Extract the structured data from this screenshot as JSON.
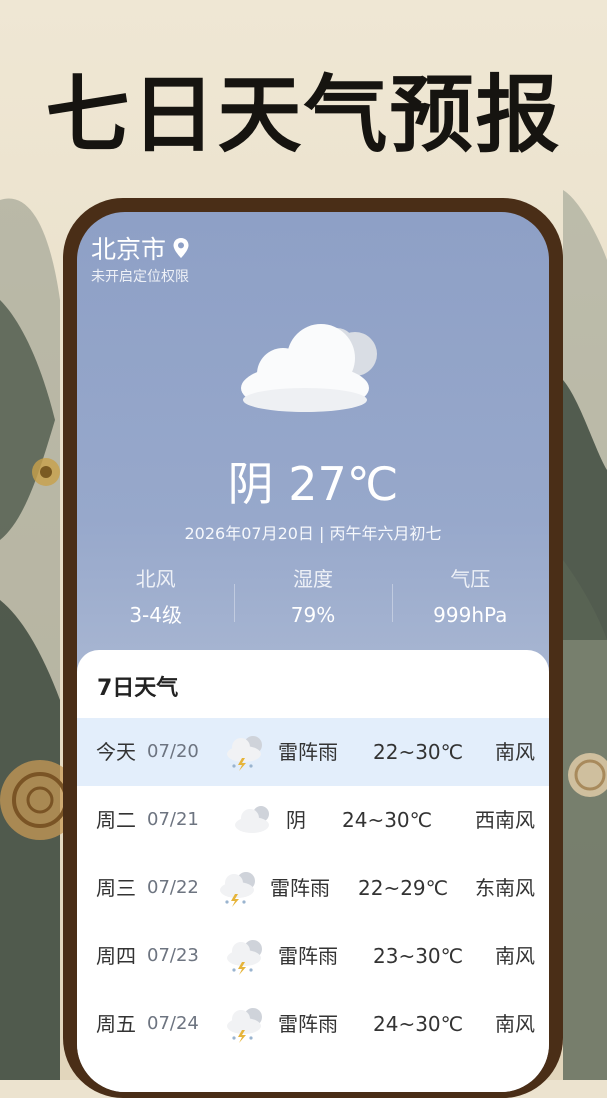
{
  "banner": {
    "title": "七日天气预报"
  },
  "location": {
    "city": "北京市",
    "permission_note": "未开启定位权限"
  },
  "current": {
    "condition": "阴",
    "temperature": "27℃",
    "date": "2026年07月20日 | 丙午年六月初七",
    "icon": "cloudy-icon",
    "stats": [
      {
        "label": "北风",
        "value": "3-4级"
      },
      {
        "label": "湿度",
        "value": "79%"
      },
      {
        "label": "气压",
        "value": "999hPa"
      }
    ]
  },
  "forecast": {
    "title": "7日天气",
    "days": [
      {
        "day": "今天",
        "date": "07/20",
        "icon": "thunderstorm-icon",
        "desc": "雷阵雨",
        "range": "22~30℃",
        "wind": "南风",
        "highlight": true
      },
      {
        "day": "周二",
        "date": "07/21",
        "icon": "cloudy-icon",
        "desc": "阴",
        "range": "24~30℃",
        "wind": "西南风",
        "highlight": false
      },
      {
        "day": "周三",
        "date": "07/22",
        "icon": "thunderstorm-icon",
        "desc": "雷阵雨",
        "range": "22~29℃",
        "wind": "东南风",
        "highlight": false
      },
      {
        "day": "周四",
        "date": "07/23",
        "icon": "thunderstorm-icon",
        "desc": "雷阵雨",
        "range": "23~30℃",
        "wind": "南风",
        "highlight": false
      },
      {
        "day": "周五",
        "date": "07/24",
        "icon": "thunderstorm-icon",
        "desc": "雷阵雨",
        "range": "24~30℃",
        "wind": "南风",
        "highlight": false
      }
    ]
  },
  "colors": {
    "frame": "#4a2e17",
    "sky_top": "#8ea0c6",
    "today_row": "#e3eefb"
  }
}
